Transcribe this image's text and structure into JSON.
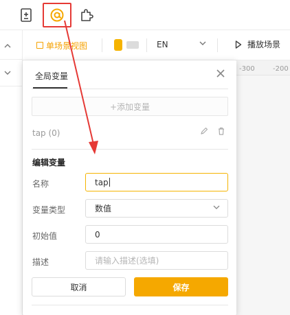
{
  "colors": {
    "accent": "#f5a800",
    "annotation_red": "#e53935",
    "toggle_on": "#f5b300"
  },
  "topbar": {
    "icons": [
      "document-plus-icon",
      "at-sign-icon",
      "puzzle-icon"
    ],
    "highlighted_icon": "at-sign-icon"
  },
  "toolbar": {
    "scene_view_label": "单场景视图",
    "language": "EN",
    "play_scene_label": "播放场景"
  },
  "ruler": {
    "labels": [
      "-300",
      "-200"
    ]
  },
  "panel": {
    "tab_label": "全局变量",
    "add_variable_label": "+添加变量",
    "variables": [
      {
        "label": "tap (0)"
      }
    ],
    "edit_section_title": "编辑变量",
    "form": {
      "name_label": "名称",
      "name_value": "tap",
      "type_label": "变量类型",
      "type_value": "数值",
      "initial_label": "初始值",
      "initial_value": "0",
      "description_label": "描述",
      "description_placeholder": "请输入描述(选填)"
    },
    "cancel_label": "取消",
    "save_label": "保存"
  }
}
